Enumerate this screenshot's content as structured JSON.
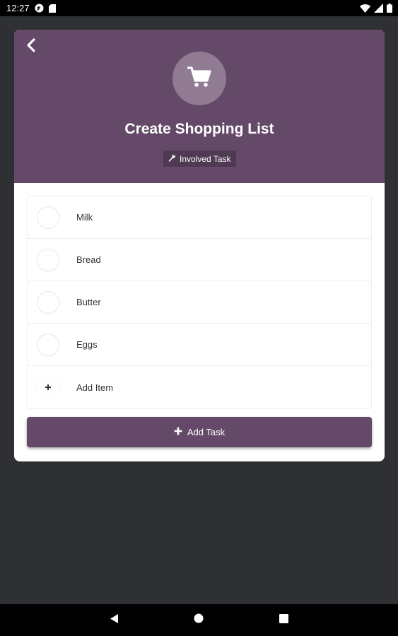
{
  "status_bar": {
    "time": "12:27"
  },
  "header": {
    "title": "Create Shopping List",
    "task_chip_label": "Involved Task",
    "icon": "shopping-cart-icon"
  },
  "items": [
    {
      "label": "Milk"
    },
    {
      "label": "Bread"
    },
    {
      "label": "Butter"
    },
    {
      "label": "Eggs"
    }
  ],
  "add_item_label": "Add Item",
  "add_task_label": "Add Task",
  "colors": {
    "accent": "#644a68",
    "accent_dark": "#4f3953",
    "icon_circle": "#907b92",
    "background": "#2f3033"
  }
}
